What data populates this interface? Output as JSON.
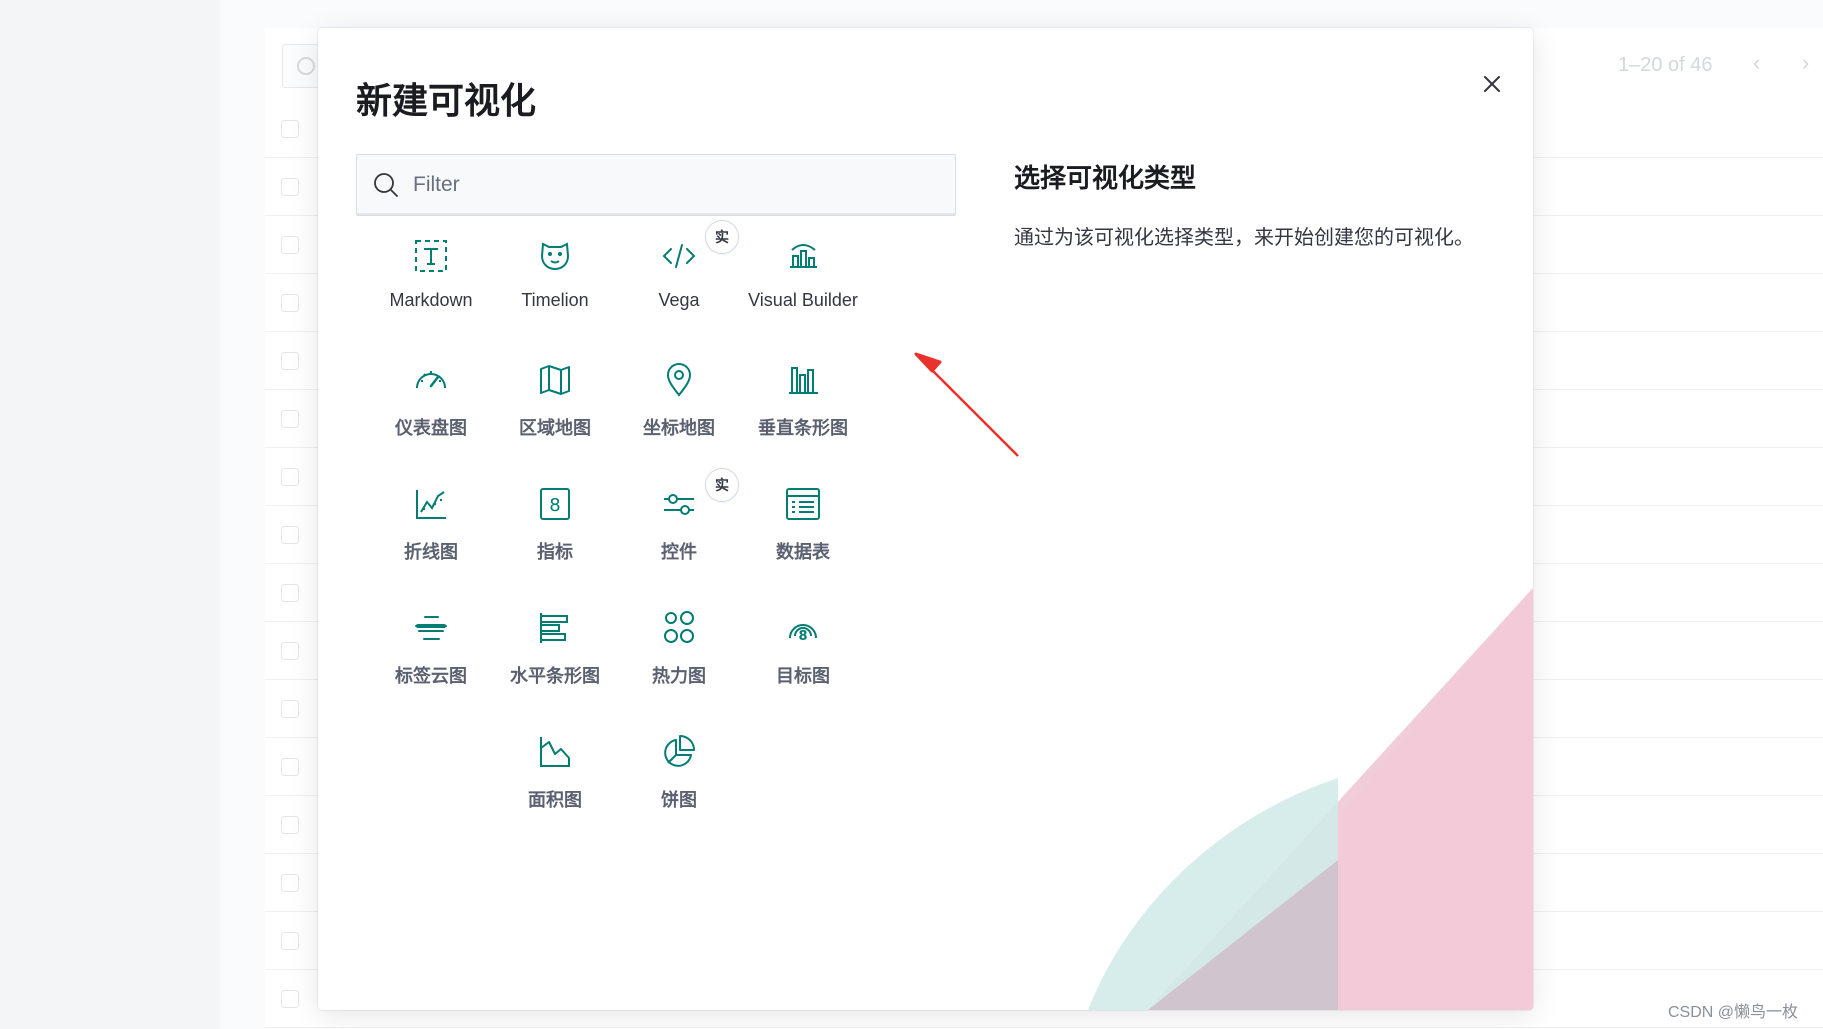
{
  "background": {
    "pagination": "1–20 of 46",
    "prev_icon": "chevron-left-icon",
    "next_icon": "chevron-right-icon"
  },
  "modal": {
    "title": "新建可视化",
    "close_icon": "close-icon",
    "filter": {
      "placeholder": "Filter",
      "value": ""
    },
    "description": {
      "title": "选择可视化类型",
      "text": "通过为该可视化选择类型，来开始创建您的可视化。"
    },
    "badge_label": "实",
    "visualizations": [
      {
        "label": "Markdown",
        "icon": "markdown-icon"
      },
      {
        "label": "Timelion",
        "icon": "timelion-icon"
      },
      {
        "label": "Vega",
        "icon": "vega-icon",
        "badge": "实"
      },
      {
        "label": "Visual Builder",
        "icon": "visual-builder-icon"
      },
      {
        "label": "仪表盘图",
        "icon": "gauge-icon"
      },
      {
        "label": "区域地图",
        "icon": "region-map-icon"
      },
      {
        "label": "坐标地图",
        "icon": "coordinate-map-icon"
      },
      {
        "label": "垂直条形图",
        "icon": "vertical-bar-icon"
      },
      {
        "label": "折线图",
        "icon": "line-chart-icon"
      },
      {
        "label": "指标",
        "icon": "metric-icon"
      },
      {
        "label": "控件",
        "icon": "controls-icon",
        "badge": "实"
      },
      {
        "label": "数据表",
        "icon": "data-table-icon"
      },
      {
        "label": "标签云图",
        "icon": "tag-cloud-icon"
      },
      {
        "label": "水平条形图",
        "icon": "horizontal-bar-icon"
      },
      {
        "label": "热力图",
        "icon": "heatmap-icon"
      },
      {
        "label": "目标图",
        "icon": "goal-icon"
      },
      {
        "label": "面积图",
        "icon": "area-chart-icon"
      },
      {
        "label": "饼图",
        "icon": "pie-chart-icon"
      }
    ]
  },
  "colors": {
    "icon_teal": "#017d73",
    "title": "#1a1c21",
    "text": "#343741",
    "arrow_red": "#e8322b",
    "deco_pink": "#f2c4d4",
    "deco_teal": "#cfe9e7"
  },
  "watermark": "CSDN @懒鸟一枚"
}
